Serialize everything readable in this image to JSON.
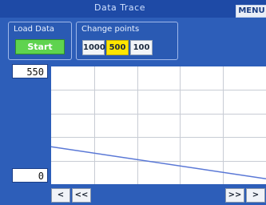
{
  "window": {
    "title": "Data Trace",
    "menu_label": "MENU"
  },
  "load_data": {
    "label": "Load Data",
    "button": "Start"
  },
  "change_points": {
    "label": "Change points",
    "options": [
      "1000",
      "500",
      "100"
    ],
    "selected": "500"
  },
  "chart": {
    "y_max_label": "550",
    "y_min_label": "0"
  },
  "navigation": {
    "prev": "<",
    "rewind": "<<",
    "forward": ">>",
    "next": ">"
  },
  "colors": {
    "background": "#2d5eb9",
    "start_button": "#5fd34f",
    "selected_option": "#ffe600",
    "trace": "#5a78d6"
  },
  "chart_data": {
    "type": "line",
    "ylim": [
      0,
      550
    ],
    "grid": true,
    "series": [
      {
        "x": [
          0,
          1
        ],
        "values": [
          175,
          25
        ]
      }
    ]
  }
}
